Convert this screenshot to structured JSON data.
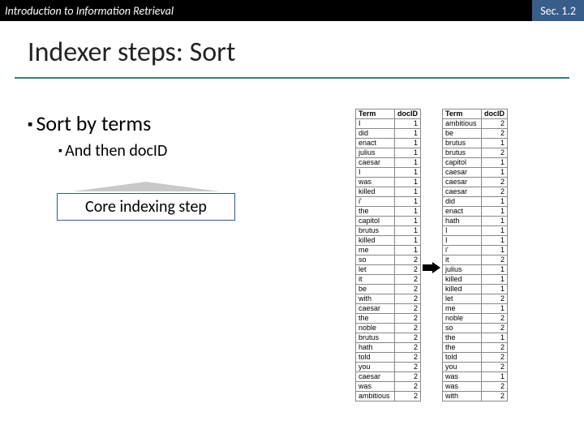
{
  "topbar": {
    "left": "Introduction to Information Retrieval",
    "right": "Sec. 1.2"
  },
  "title": "Indexer steps: Sort",
  "bullets": {
    "l1": "Sort by terms",
    "l2": "And then docID"
  },
  "callout": "Core indexing step",
  "headers": {
    "term": "Term",
    "doc": "docID"
  },
  "left_table": [
    [
      "I",
      1
    ],
    [
      "did",
      1
    ],
    [
      "enact",
      1
    ],
    [
      "julius",
      1
    ],
    [
      "caesar",
      1
    ],
    [
      "I",
      1
    ],
    [
      "was",
      1
    ],
    [
      "killed",
      1
    ],
    [
      "i'",
      1
    ],
    [
      "the",
      1
    ],
    [
      "capitol",
      1
    ],
    [
      "brutus",
      1
    ],
    [
      "killed",
      1
    ],
    [
      "me",
      1
    ],
    [
      "so",
      2
    ],
    [
      "let",
      2
    ],
    [
      "it",
      2
    ],
    [
      "be",
      2
    ],
    [
      "with",
      2
    ],
    [
      "caesar",
      2
    ],
    [
      "the",
      2
    ],
    [
      "noble",
      2
    ],
    [
      "brutus",
      2
    ],
    [
      "hath",
      2
    ],
    [
      "told",
      2
    ],
    [
      "you",
      2
    ],
    [
      "caesar",
      2
    ],
    [
      "was",
      2
    ],
    [
      "ambitious",
      2
    ]
  ],
  "right_table": [
    [
      "ambitious",
      2
    ],
    [
      "be",
      2
    ],
    [
      "brutus",
      1
    ],
    [
      "brutus",
      2
    ],
    [
      "capitol",
      1
    ],
    [
      "caesar",
      1
    ],
    [
      "caesar",
      2
    ],
    [
      "caesar",
      2
    ],
    [
      "did",
      1
    ],
    [
      "enact",
      1
    ],
    [
      "hath",
      1
    ],
    [
      "I",
      1
    ],
    [
      "I",
      1
    ],
    [
      "i'",
      1
    ],
    [
      "it",
      2
    ],
    [
      "julius",
      1
    ],
    [
      "killed",
      1
    ],
    [
      "killed",
      1
    ],
    [
      "let",
      2
    ],
    [
      "me",
      1
    ],
    [
      "noble",
      2
    ],
    [
      "so",
      2
    ],
    [
      "the",
      1
    ],
    [
      "the",
      2
    ],
    [
      "told",
      2
    ],
    [
      "you",
      2
    ],
    [
      "was",
      1
    ],
    [
      "was",
      2
    ],
    [
      "with",
      2
    ]
  ]
}
